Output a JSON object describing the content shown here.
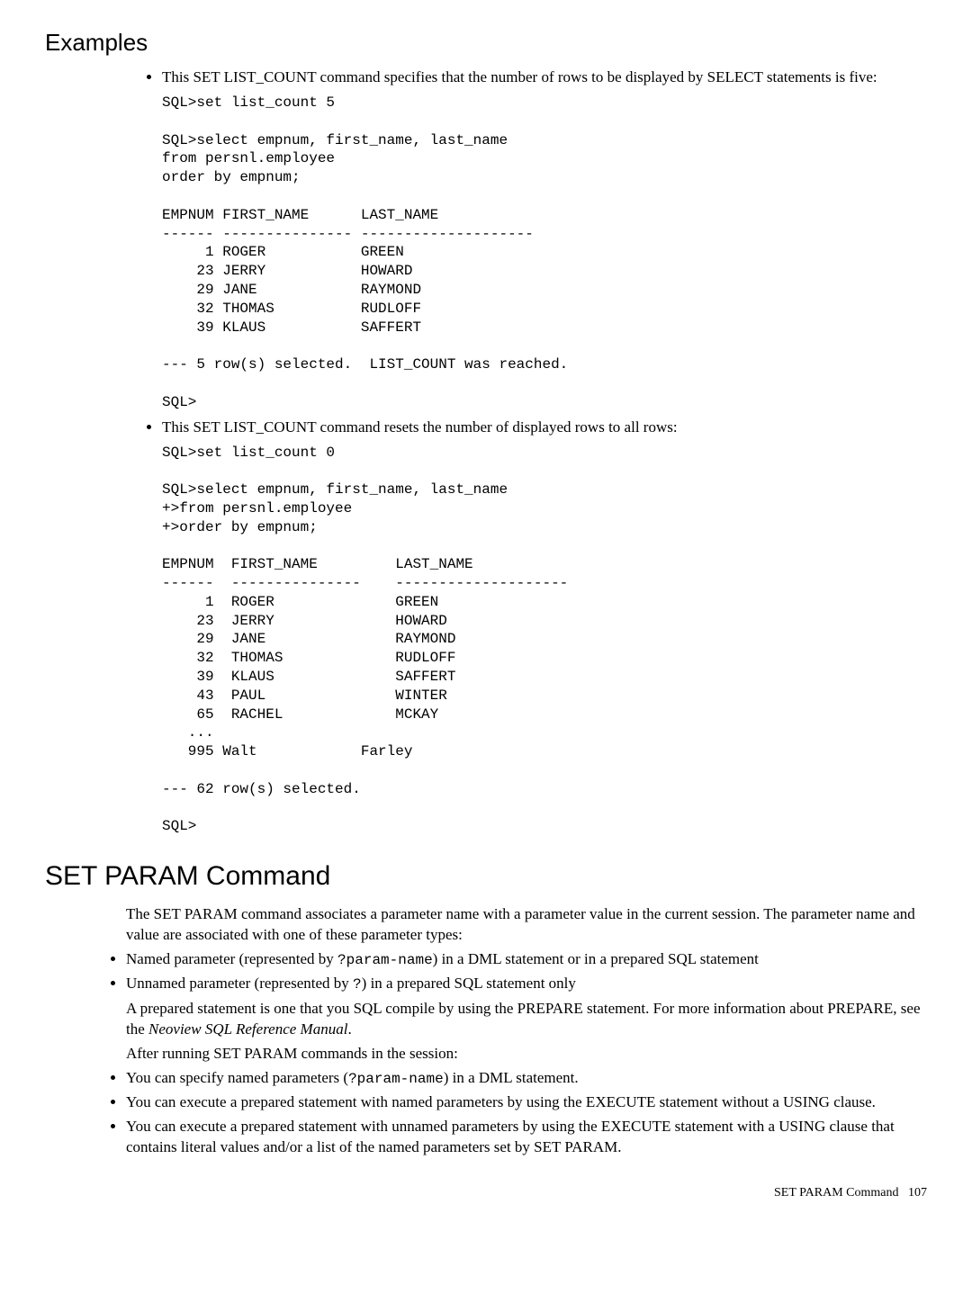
{
  "heading_examples": "Examples",
  "bullet1": "This SET LIST_COUNT command specifies that the number of rows to be displayed by SELECT statements is five:",
  "code1": "SQL>set list_count 5\n\nSQL>select empnum, first_name, last_name\nfrom persnl.employee\norder by empnum;\n\nEMPNUM FIRST_NAME      LAST_NAME\n------ --------------- --------------------\n     1 ROGER           GREEN\n    23 JERRY           HOWARD\n    29 JANE            RAYMOND\n    32 THOMAS          RUDLOFF\n    39 KLAUS           SAFFERT\n\n--- 5 row(s) selected.  LIST_COUNT was reached.\n\nSQL>",
  "bullet2": "This SET LIST_COUNT command resets the number of displayed rows to all rows:",
  "code2": "SQL>set list_count 0\n\nSQL>select empnum, first_name, last_name\n+>from persnl.employee\n+>order by empnum;\n\nEMPNUM  FIRST_NAME         LAST_NAME\n------  ---------------    --------------------\n     1  ROGER              GREEN\n    23  JERRY              HOWARD\n    29  JANE               RAYMOND\n    32  THOMAS             RUDLOFF\n    39  KLAUS              SAFFERT\n    43  PAUL               WINTER\n    65  RACHEL             MCKAY\n   ...\n   995 Walt            Farley\n\n--- 62 row(s) selected.\n\nSQL>",
  "heading_setparam": "SET PARAM Command",
  "para1": "The SET PARAM command associates a parameter name with a parameter value in the current session. The parameter name and value are associated with one of these parameter types:",
  "b_named_pre": "Named parameter (represented by ",
  "b_named_code": "?param-name",
  "b_named_post": ") in a DML statement or in a prepared SQL statement",
  "b_unnamed_pre": "Unnamed parameter (represented by ",
  "b_unnamed_code": "?",
  "b_unnamed_post": ") in a prepared SQL statement only",
  "para2_pre": "A prepared statement is one that you SQL compile by using the PREPARE statement. For more information about PREPARE, see the ",
  "para2_ital": "Neoview SQL Reference Manual",
  "para2_post": ".",
  "para3": "After running SET PARAM commands in the session:",
  "b_spec_pre": "You can specify named parameters (",
  "b_spec_code": "?param-name",
  "b_spec_post": ") in a DML statement.",
  "b_exec1": "You can execute a prepared statement with named parameters by using the EXECUTE statement without a USING clause.",
  "b_exec2": "You can execute a prepared statement with unnamed parameters by using the EXECUTE statement with a USING clause that contains literal values and/or a list of the named parameters set by SET PARAM.",
  "footer_label": "SET PARAM Command",
  "footer_page": "107"
}
